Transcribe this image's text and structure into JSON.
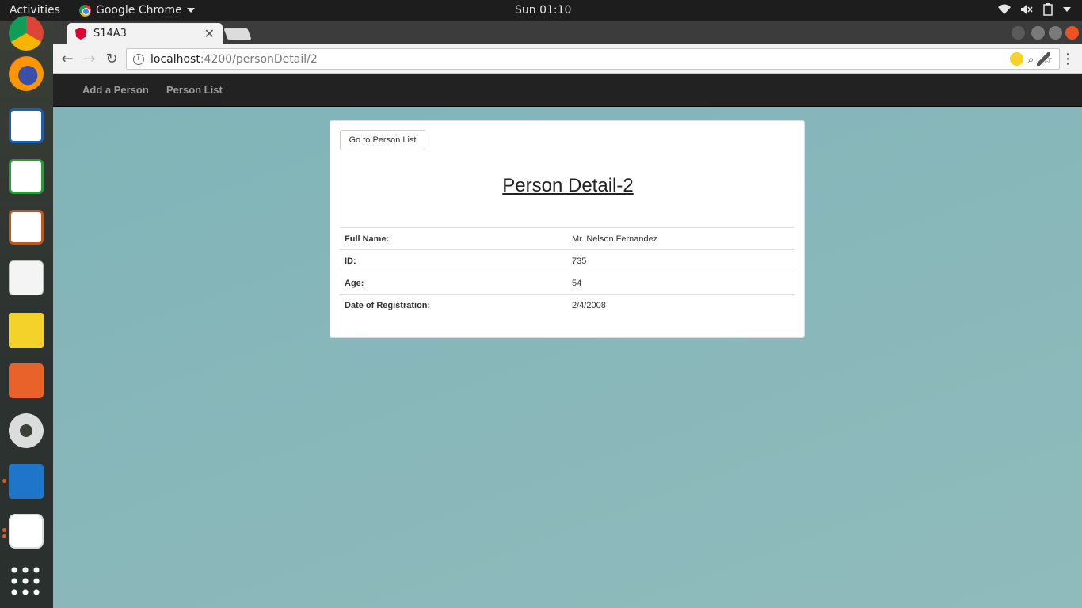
{
  "os": {
    "activities": "Activities",
    "app_menu": "Google Chrome",
    "clock": "Sun 01:10"
  },
  "dock": {
    "items": [
      "Chrome",
      "Firefox",
      "Writer",
      "Calc",
      "Impress",
      "Text Editor",
      "Notes",
      "Software",
      "Settings",
      "VS Code",
      "Reader",
      "Show Applications"
    ]
  },
  "browser": {
    "tab_title": "S14A3",
    "url_host": "localhost",
    "url_path": ":4200/personDetail/2"
  },
  "navbar": {
    "add_person": "Add a Person",
    "person_list": "Person List"
  },
  "detail": {
    "back_button": "Go to Person List",
    "heading": "Person Detail-2",
    "rows": [
      {
        "label": "Full Name:",
        "value": "Mr. Nelson Fernandez"
      },
      {
        "label": "ID:",
        "value": "735"
      },
      {
        "label": "Age:",
        "value": "54"
      },
      {
        "label": "Date of Registration:",
        "value": "2/4/2008"
      }
    ]
  },
  "colors": {
    "page_bg": "#86b8ba",
    "navbar_bg": "#222222",
    "accent_orange": "#e95420"
  }
}
